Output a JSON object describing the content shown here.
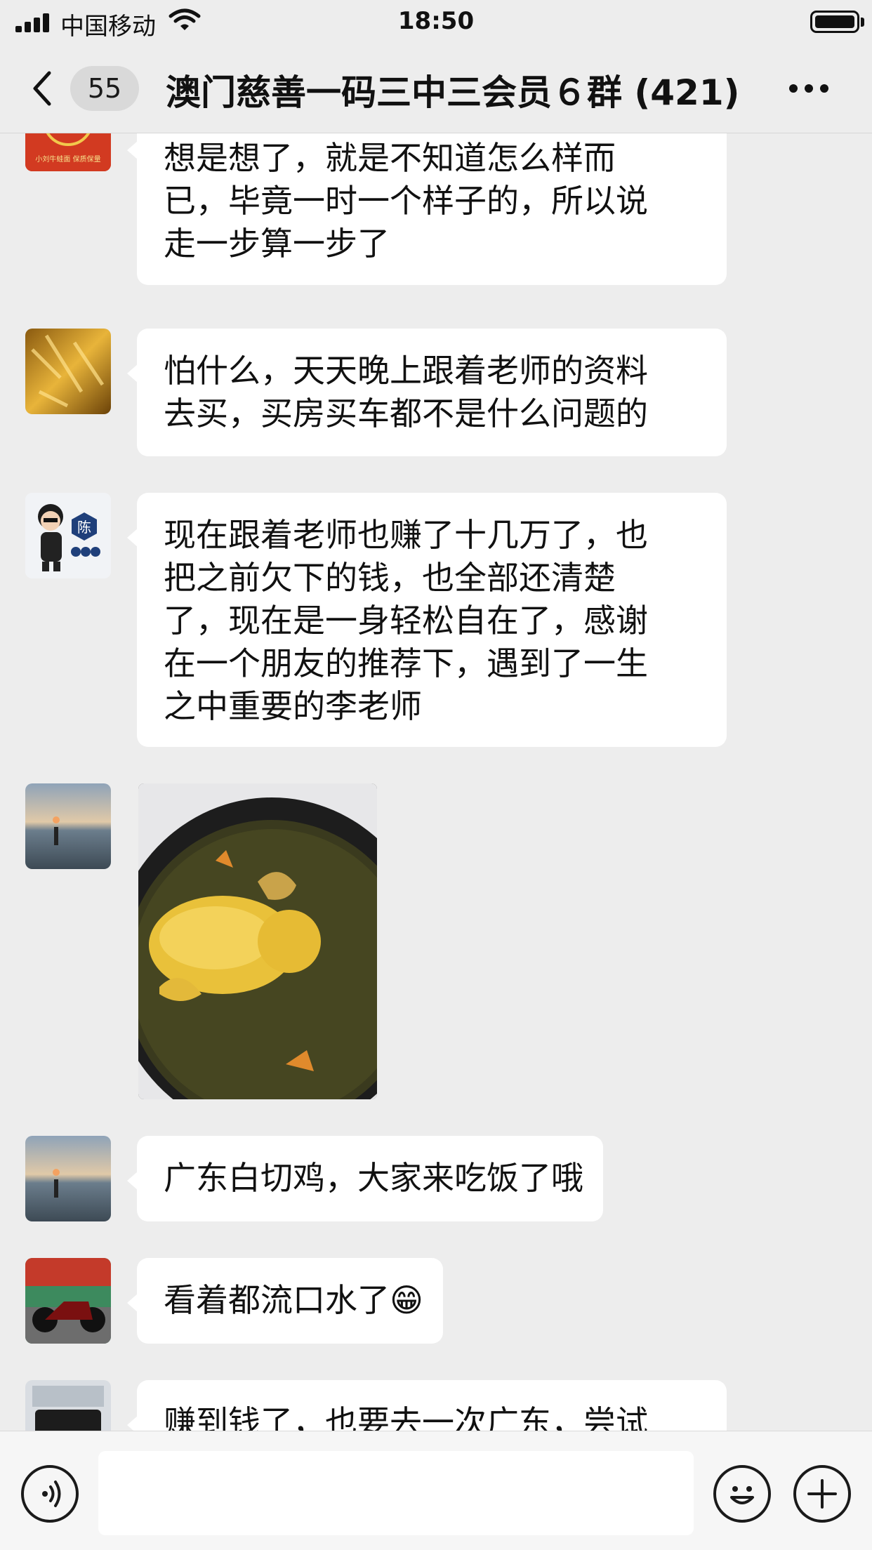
{
  "status_bar": {
    "carrier": "中国移动",
    "time": "18:50"
  },
  "nav": {
    "unread_count": "55",
    "title": "澳门慈善一码三中三会员６群 (421)"
  },
  "messages": [
    {
      "avatar": "red-avatar-liu",
      "avatar_char": "刘",
      "avatar_caption": "小刘牛蛙面 保质保量",
      "lines": [
        "想是想了，就是不知道怎么样而",
        "已，毕竟一时一个样子的，所以说",
        "走一步算一步了"
      ]
    },
    {
      "avatar": "golden-leaves-avatar",
      "lines": [
        "怕什么，天天晚上跟着老师的资料",
        "去买，买房买车都不是什么问题的"
      ]
    },
    {
      "avatar": "cartoon-chen-avatar",
      "avatar_char": "陈",
      "lines": [
        "现在跟着老师也赚了十几万了，也",
        "把之前欠下的钱，也全部还清楚",
        "了，现在是一身轻松自在了，感谢",
        "在一个朋友的推荐下，遇到了一生",
        "之中重要的李老师"
      ]
    },
    {
      "avatar": "beach-sunset-avatar",
      "image": "white-cut-chicken-photo"
    },
    {
      "avatar": "beach-sunset-avatar",
      "lines": [
        "广东白切鸡，大家来吃饭了哦"
      ]
    },
    {
      "avatar": "motorcycle-avatar",
      "lines": [
        "看着都流口水了"
      ],
      "emoji": "😁"
    },
    {
      "avatar": "car-avatar",
      "lines": [
        "赚到钱了，也要去一次广东，尝试"
      ]
    }
  ],
  "input": {
    "placeholder": ""
  },
  "colors": {
    "background": "#ededed",
    "bubble": "#ffffff",
    "text": "#111111"
  }
}
